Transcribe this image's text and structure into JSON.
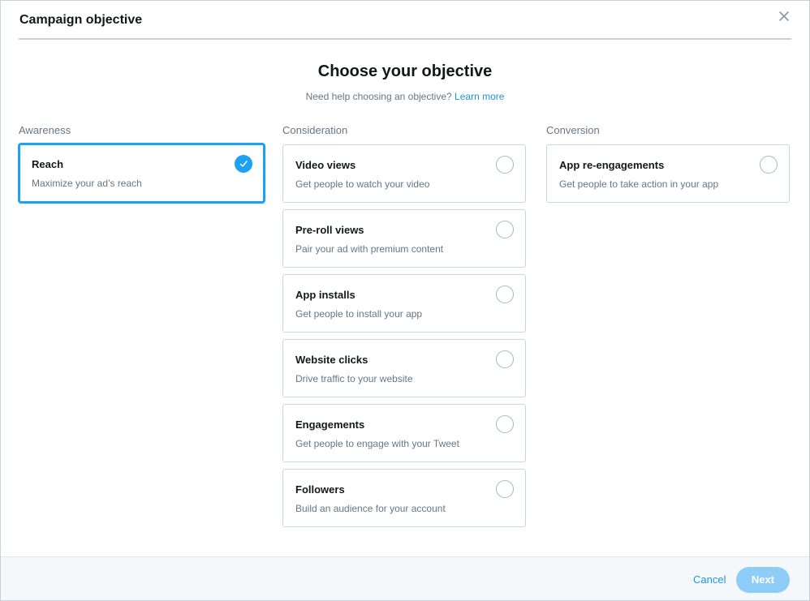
{
  "header": {
    "title": "Campaign objective",
    "close_icon": "close-icon"
  },
  "intro": {
    "title": "Choose your objective",
    "help_text": "Need help choosing an objective?",
    "learn_more": "Learn more"
  },
  "columns": [
    {
      "label": "Awareness",
      "options": [
        {
          "title": "Reach",
          "description": "Maximize your ad’s reach",
          "selected": true
        }
      ]
    },
    {
      "label": "Consideration",
      "options": [
        {
          "title": "Video views",
          "description": "Get people to watch your video",
          "selected": false
        },
        {
          "title": "Pre-roll views",
          "description": "Pair your ad with premium content",
          "selected": false
        },
        {
          "title": "App installs",
          "description": "Get people to install your app",
          "selected": false
        },
        {
          "title": "Website clicks",
          "description": "Drive traffic to your website",
          "selected": false
        },
        {
          "title": "Engagements",
          "description": "Get people to engage with your Tweet",
          "selected": false
        },
        {
          "title": "Followers",
          "description": "Build an audience for your account",
          "selected": false
        }
      ]
    },
    {
      "label": "Conversion",
      "options": [
        {
          "title": "App re-engagements",
          "description": "Get people to take action in your app",
          "selected": false
        }
      ]
    }
  ],
  "footer": {
    "cancel_label": "Cancel",
    "next_label": "Next"
  },
  "colors": {
    "accent": "#1da1f2",
    "link": "#1b95e0",
    "next_disabled": "#8ecdf7",
    "muted_text": "#657786"
  }
}
